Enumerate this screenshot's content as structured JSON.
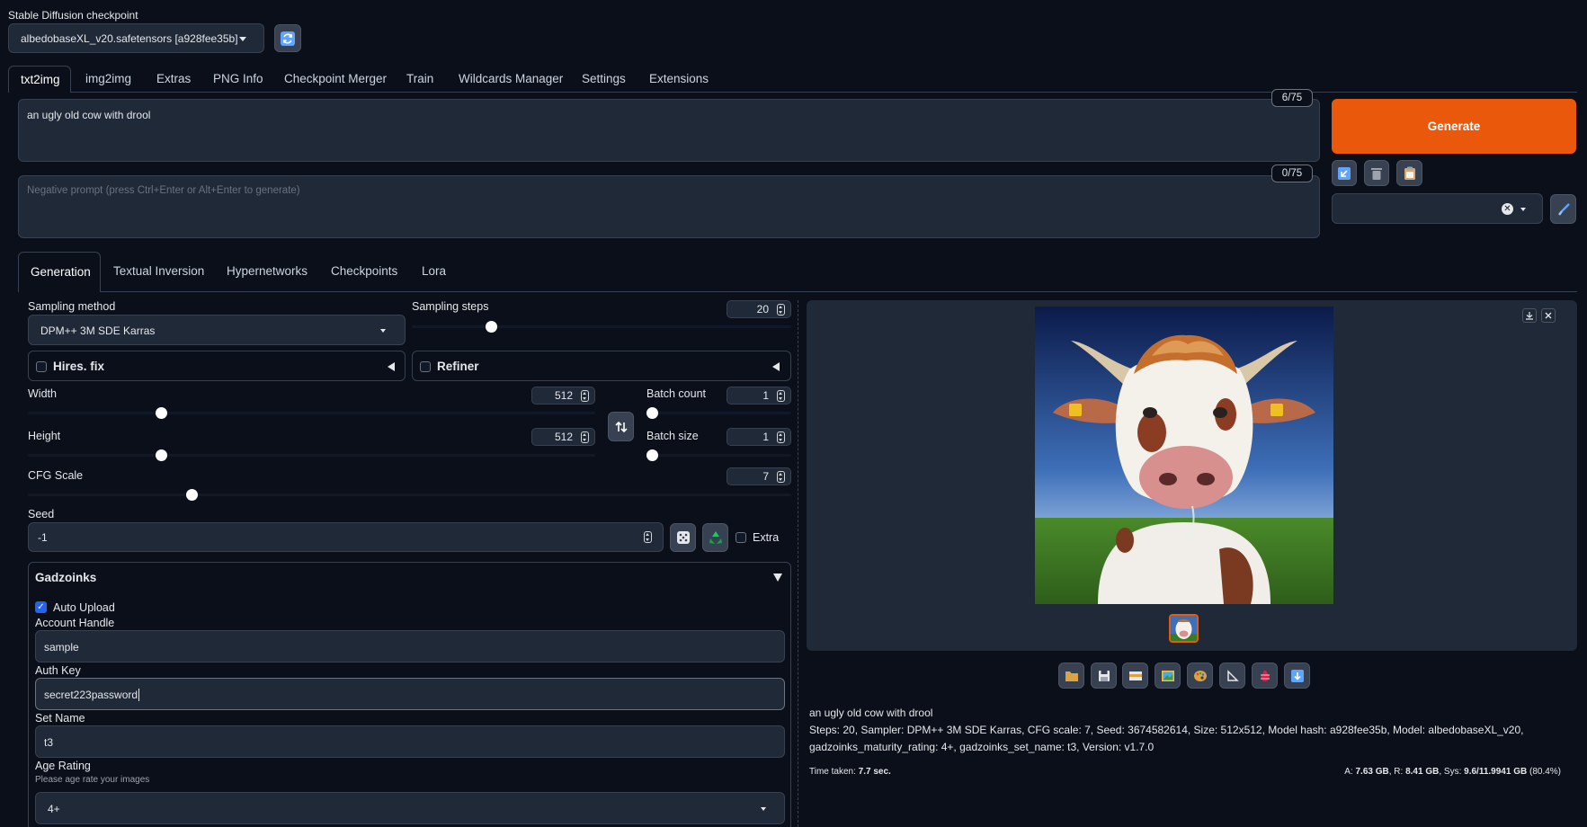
{
  "checkpoint": {
    "label": "Stable Diffusion checkpoint",
    "value": "albedobaseXL_v20.safetensors [a928fee35b]"
  },
  "main_tabs": [
    "txt2img",
    "img2img",
    "Extras",
    "PNG Info",
    "Checkpoint Merger",
    "Train",
    "Wildcards Manager",
    "Settings",
    "Extensions"
  ],
  "prompt": {
    "value": "an ugly old cow with drool",
    "token_count": "6/75"
  },
  "negative_prompt": {
    "placeholder": "Negative prompt (press Ctrl+Enter or Alt+Enter to generate)",
    "token_count": "0/75"
  },
  "generate_label": "Generate",
  "sub_tabs": [
    "Generation",
    "Textual Inversion",
    "Hypernetworks",
    "Checkpoints",
    "Lora"
  ],
  "sampling_method": {
    "label": "Sampling method",
    "value": "DPM++ 3M SDE Karras"
  },
  "sampling_steps": {
    "label": "Sampling steps",
    "value": "20",
    "fraction": 0.2
  },
  "hires_fix": {
    "label": "Hires. fix"
  },
  "refiner": {
    "label": "Refiner"
  },
  "width": {
    "label": "Width",
    "value": "512",
    "fraction": 0.23
  },
  "height": {
    "label": "Height",
    "value": "512",
    "fraction": 0.23
  },
  "batch_count": {
    "label": "Batch count",
    "value": "1",
    "fraction": 0.0
  },
  "batch_size": {
    "label": "Batch size",
    "value": "1",
    "fraction": 0.0
  },
  "cfg_scale": {
    "label": "CFG Scale",
    "value": "7",
    "fraction": 0.21
  },
  "seed": {
    "label": "Seed",
    "value": "-1",
    "extra_label": "Extra"
  },
  "gadzoinks": {
    "title": "Gadzoinks",
    "auto_upload_label": "Auto Upload",
    "account_handle_label": "Account Handle",
    "account_handle_value": "sample",
    "auth_key_label": "Auth Key",
    "auth_key_value": "secret223password",
    "set_name_label": "Set Name",
    "set_name_value": "t3",
    "age_rating_label": "Age Rating",
    "age_rating_hint": "Please age rate your images",
    "age_rating_value": "4+"
  },
  "output": {
    "caption": "an ugly old cow with drool",
    "params_line1": "Steps: 20, Sampler: DPM++ 3M SDE Karras, CFG scale: 7, Seed: 3674582614, Size: 512x512, Model hash: a928fee35b, Model: albedobaseXL_v20,",
    "params_line2": "gadzoinks_maturity_rating: 4+, gadzoinks_set_name: t3, Version: v1.7.0",
    "time_label": "Time taken:",
    "time_value": "7.7 sec.",
    "mem_a_label": "A:",
    "mem_a": "7.63 GB",
    "mem_r_label": ", R:",
    "mem_r": "8.41 GB",
    "mem_sys_label": ", Sys:",
    "mem_sys": "9.6/11.9941 GB",
    "mem_pct": "(80.4%)"
  },
  "colors": {
    "generate": "#ea580c",
    "accent_check": "#2563eb",
    "background": "#0b0f19",
    "panel": "#1f2937"
  }
}
